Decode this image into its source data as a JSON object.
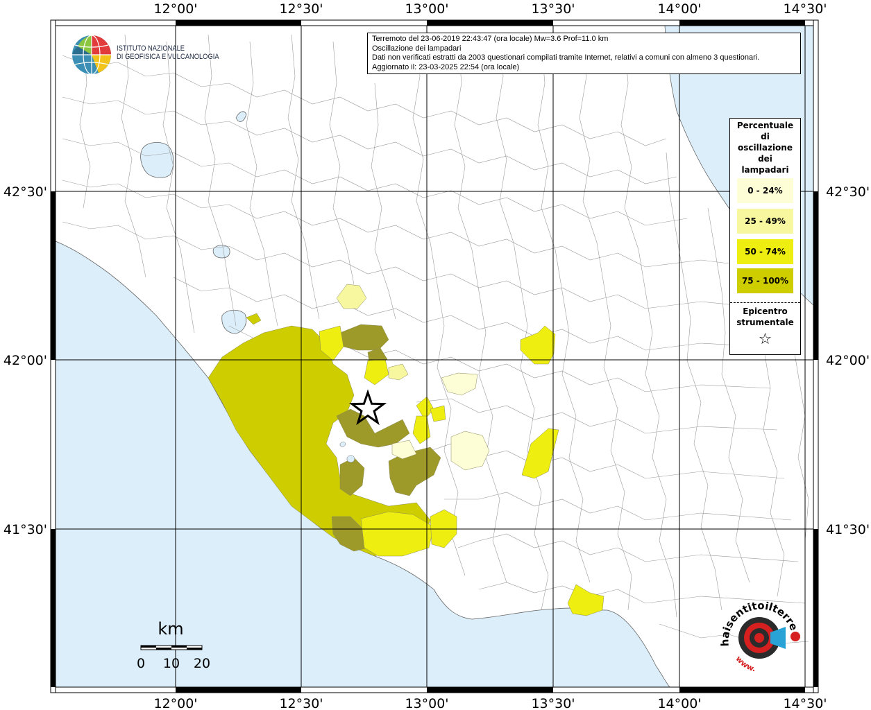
{
  "map": {
    "x_ticks_top": [
      "12°00'",
      "12°30'",
      "13°00'",
      "13°30'",
      "14°00'",
      "14°30'"
    ],
    "x_ticks_bottom": [
      "12°00'",
      "12°30'",
      "13°00'",
      "13°30'",
      "14°00'",
      "14°30'"
    ],
    "y_ticks_left": [
      "42°30'",
      "42°00'",
      "41°30'"
    ],
    "y_ticks_right": [
      "42°30'",
      "42°00'",
      "41°30'"
    ],
    "colors": {
      "sea": "#dbeefa",
      "land": "#ffffff",
      "border": "#999999",
      "grid": "#000000",
      "class_0_24": "#fdfdd6",
      "class_25_49": "#f7f7a0",
      "class_50_74": "#eeee10",
      "class_75_100": "#cdcd00",
      "class_dark": "#9e9a2a"
    }
  },
  "info": {
    "line1": "Terremoto del 23-06-2019 22:43:47 (ora locale) Mw=3.6 Prof=11.0 km",
    "line2": "Oscillazione dei lampadari",
    "line3": "Dati non verificati estratti da 2003 questionari compilati tramite Internet, relativi a comuni con almeno 3 questionari.",
    "line4": "Aggiornato il: 23-03-2025 22:54 (ora locale)"
  },
  "logo": {
    "line1": "ISTITUTO NAZIONALE",
    "line2": "DI GEOFISICA E VULCANOLOGIA"
  },
  "legend": {
    "title_lines": [
      "Percentuale",
      "di",
      "oscillazione",
      "dei",
      "lampadari"
    ],
    "items": [
      {
        "label": "0 - 24%",
        "color": "#fdfdd6"
      },
      {
        "label": "25 - 49%",
        "color": "#f7f7a0"
      },
      {
        "label": "50 - 74%",
        "color": "#eeee10"
      },
      {
        "label": "75 - 100%",
        "color": "#cdcd00"
      }
    ],
    "epicenter_line1": "Epicentro",
    "epicenter_line2": "strumentale",
    "epicenter_symbol": "☆"
  },
  "scale": {
    "unit": "km",
    "labels": [
      "0",
      "10",
      "20"
    ]
  },
  "stamp": {
    "ring_top": "haisentitoilterremoto.it",
    "ring_bottom": "www."
  }
}
